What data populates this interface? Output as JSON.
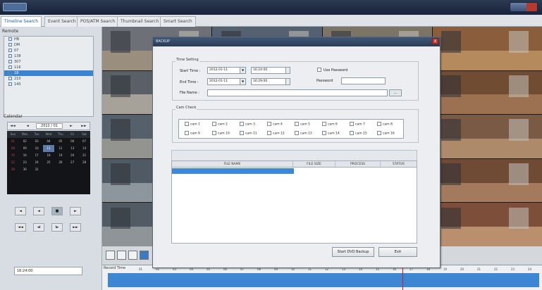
{
  "tabs": [
    "Timeline Search",
    "Event Search",
    "POS/ATM Search",
    "Thumbnail Search",
    "Smart Search"
  ],
  "remote": {
    "label": "Remote",
    "items": [
      "HB",
      "DM",
      "07",
      "138",
      "307",
      "116",
      "18",
      "210",
      "140"
    ],
    "selected_index": 6
  },
  "calendar": {
    "label": "Calendar",
    "month": "2012 / 01",
    "prev_year": "◄◄",
    "prev_month": "◄",
    "next_month": "►",
    "next_year": "►►",
    "dow": [
      "Sun",
      "Mon",
      "Tue",
      "Wed",
      "Thu",
      "Fri",
      "Sat"
    ],
    "weeks": [
      [
        "01",
        "02",
        "03",
        "04",
        "05",
        "06",
        "07"
      ],
      [
        "08",
        "09",
        "10",
        "11",
        "12",
        "13",
        "14"
      ],
      [
        "15",
        "16",
        "17",
        "18",
        "19",
        "20",
        "21"
      ],
      [
        "22",
        "23",
        "24",
        "25",
        "26",
        "27",
        "28"
      ],
      [
        "29",
        "30",
        "31",
        "",
        "",
        "",
        ""
      ]
    ],
    "today": "11"
  },
  "playback": {
    "row1": [
      "◄",
      "◄",
      "■",
      "►"
    ],
    "row2": [
      "◄◄",
      "◄I",
      "I►",
      "►►"
    ],
    "time": "16:24:00"
  },
  "timeline": {
    "label": "Record Time",
    "ticks": [
      "01",
      "02",
      "03",
      "04",
      "05",
      "06",
      "07",
      "08",
      "09",
      "10",
      "11",
      "12",
      "13",
      "14",
      "15",
      "16",
      "17",
      "18",
      "19",
      "20",
      "21",
      "22",
      "23",
      "24"
    ]
  },
  "dialog": {
    "title": "BACKUP",
    "close": "x",
    "time_setting": {
      "label": "Time Setting",
      "start_label": "Start Time :",
      "start_date": "2012-01-11",
      "start_time": "16:24:00",
      "end_label": "End Time :",
      "end_date": "2012-01-11",
      "end_time": "16:29:00",
      "file_name_label": "File Name :",
      "file_name": "",
      "browse": "...",
      "use_password": "Use Password",
      "password_label": "Password",
      "password": ""
    },
    "cam_check": {
      "label": "Cam Check",
      "cams": [
        "cam 1",
        "cam 2",
        "cam 3",
        "cam 4",
        "cam 5",
        "cam 6",
        "cam 7",
        "cam 8",
        "cam 9",
        "cam 10",
        "cam 11",
        "cam 12",
        "cam 13",
        "cam 14",
        "cam 15",
        "cam 16"
      ]
    },
    "table": {
      "headers": [
        "FILE NAME",
        "FILE SIZE",
        "PROCESS",
        "STATUS"
      ]
    },
    "start_button": "Start DVD Backup",
    "exit_button": "Exit"
  },
  "colors": {
    "accent": "#3d87da",
    "titlebar": "#2a3b56",
    "timeline_bar": "#3d86d4",
    "marker": "#c32020"
  }
}
